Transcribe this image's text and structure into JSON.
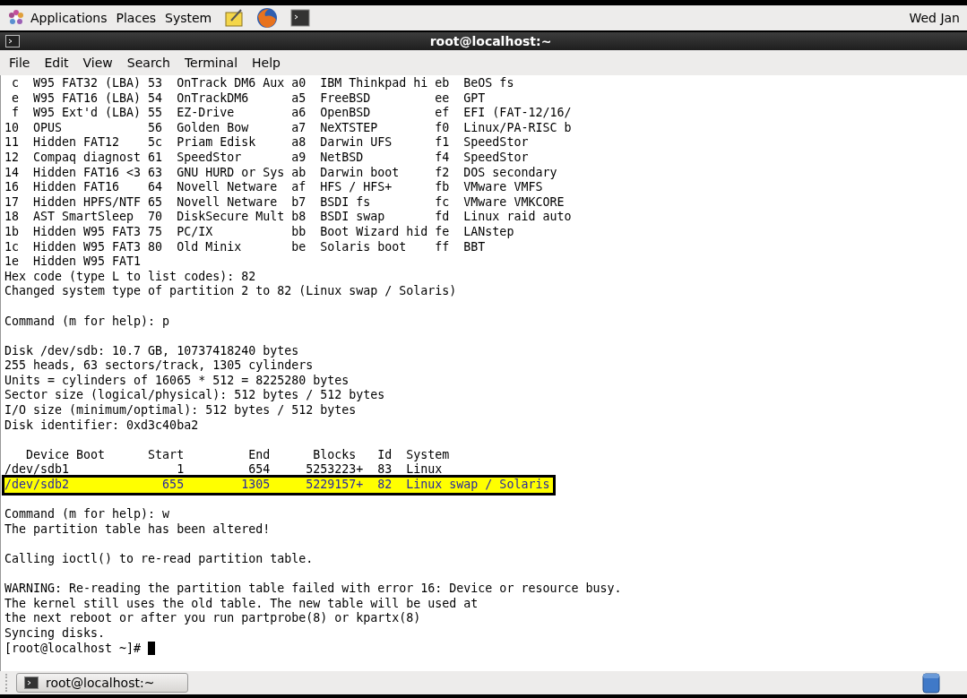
{
  "top_panel": {
    "menus": [
      "Applications",
      "Places",
      "System"
    ],
    "clock": "Wed Jan"
  },
  "window": {
    "title": "root@localhost:~"
  },
  "menubar": [
    "File",
    "Edit",
    "View",
    "Search",
    "Terminal",
    "Help"
  ],
  "terminal_lines": [
    {
      "kind": "text",
      "text": " c  W95 FAT32 (LBA) 53  OnTrack DM6 Aux a0  IBM Thinkpad hi eb  BeOS fs"
    },
    {
      "kind": "text",
      "text": " e  W95 FAT16 (LBA) 54  OnTrackDM6      a5  FreeBSD         ee  GPT"
    },
    {
      "kind": "text",
      "text": " f  W95 Ext'd (LBA) 55  EZ-Drive        a6  OpenBSD         ef  EFI (FAT-12/16/"
    },
    {
      "kind": "text",
      "text": "10  OPUS            56  Golden Bow      a7  NeXTSTEP        f0  Linux/PA-RISC b"
    },
    {
      "kind": "text",
      "text": "11  Hidden FAT12    5c  Priam Edisk     a8  Darwin UFS      f1  SpeedStor"
    },
    {
      "kind": "text",
      "text": "12  Compaq diagnost 61  SpeedStor       a9  NetBSD          f4  SpeedStor"
    },
    {
      "kind": "text",
      "text": "14  Hidden FAT16 <3 63  GNU HURD or Sys ab  Darwin boot     f2  DOS secondary"
    },
    {
      "kind": "text",
      "text": "16  Hidden FAT16    64  Novell Netware  af  HFS / HFS+      fb  VMware VMFS"
    },
    {
      "kind": "text",
      "text": "17  Hidden HPFS/NTF 65  Novell Netware  b7  BSDI fs         fc  VMware VMKCORE"
    },
    {
      "kind": "text",
      "text": "18  AST SmartSleep  70  DiskSecure Mult b8  BSDI swap       fd  Linux raid auto"
    },
    {
      "kind": "text",
      "text": "1b  Hidden W95 FAT3 75  PC/IX           bb  Boot Wizard hid fe  LANstep"
    },
    {
      "kind": "text",
      "text": "1c  Hidden W95 FAT3 80  Old Minix       be  Solaris boot    ff  BBT"
    },
    {
      "kind": "text",
      "text": "1e  Hidden W95 FAT1"
    },
    {
      "kind": "text",
      "text": "Hex code (type L to list codes): 82"
    },
    {
      "kind": "text",
      "text": "Changed system type of partition 2 to 82 (Linux swap / Solaris)"
    },
    {
      "kind": "blank"
    },
    {
      "kind": "text",
      "text": "Command (m for help): p"
    },
    {
      "kind": "blank"
    },
    {
      "kind": "text",
      "text": "Disk /dev/sdb: 10.7 GB, 10737418240 bytes"
    },
    {
      "kind": "text",
      "text": "255 heads, 63 sectors/track, 1305 cylinders"
    },
    {
      "kind": "text",
      "text": "Units = cylinders of 16065 * 512 = 8225280 bytes"
    },
    {
      "kind": "text",
      "text": "Sector size (logical/physical): 512 bytes / 512 bytes"
    },
    {
      "kind": "text",
      "text": "I/O size (minimum/optimal): 512 bytes / 512 bytes"
    },
    {
      "kind": "text",
      "text": "Disk identifier: 0xd3c40ba2"
    },
    {
      "kind": "blank"
    },
    {
      "kind": "text",
      "text": "   Device Boot      Start         End      Blocks   Id  System"
    },
    {
      "kind": "text",
      "text": "/dev/sdb1               1         654     5253223+  83  Linux"
    },
    {
      "kind": "highlight",
      "text": "/dev/sdb2             655        1305     5229157+  82  Linux swap / Solaris"
    },
    {
      "kind": "blank"
    },
    {
      "kind": "text",
      "text": "Command (m for help): w"
    },
    {
      "kind": "text",
      "text": "The partition table has been altered!"
    },
    {
      "kind": "blank"
    },
    {
      "kind": "text",
      "text": "Calling ioctl() to re-read partition table."
    },
    {
      "kind": "blank"
    },
    {
      "kind": "text",
      "text": "WARNING: Re-reading the partition table failed with error 16: Device or resource busy."
    },
    {
      "kind": "text",
      "text": "The kernel still uses the old table. The new table will be used at"
    },
    {
      "kind": "text",
      "text": "the next reboot or after you run partprobe(8) or kpartx(8)"
    },
    {
      "kind": "text",
      "text": "Syncing disks."
    },
    {
      "kind": "prompt",
      "text": "[root@localhost ~]#"
    }
  ],
  "taskbar": {
    "items": [
      {
        "label": "root@localhost:~",
        "selected": false
      }
    ]
  }
}
